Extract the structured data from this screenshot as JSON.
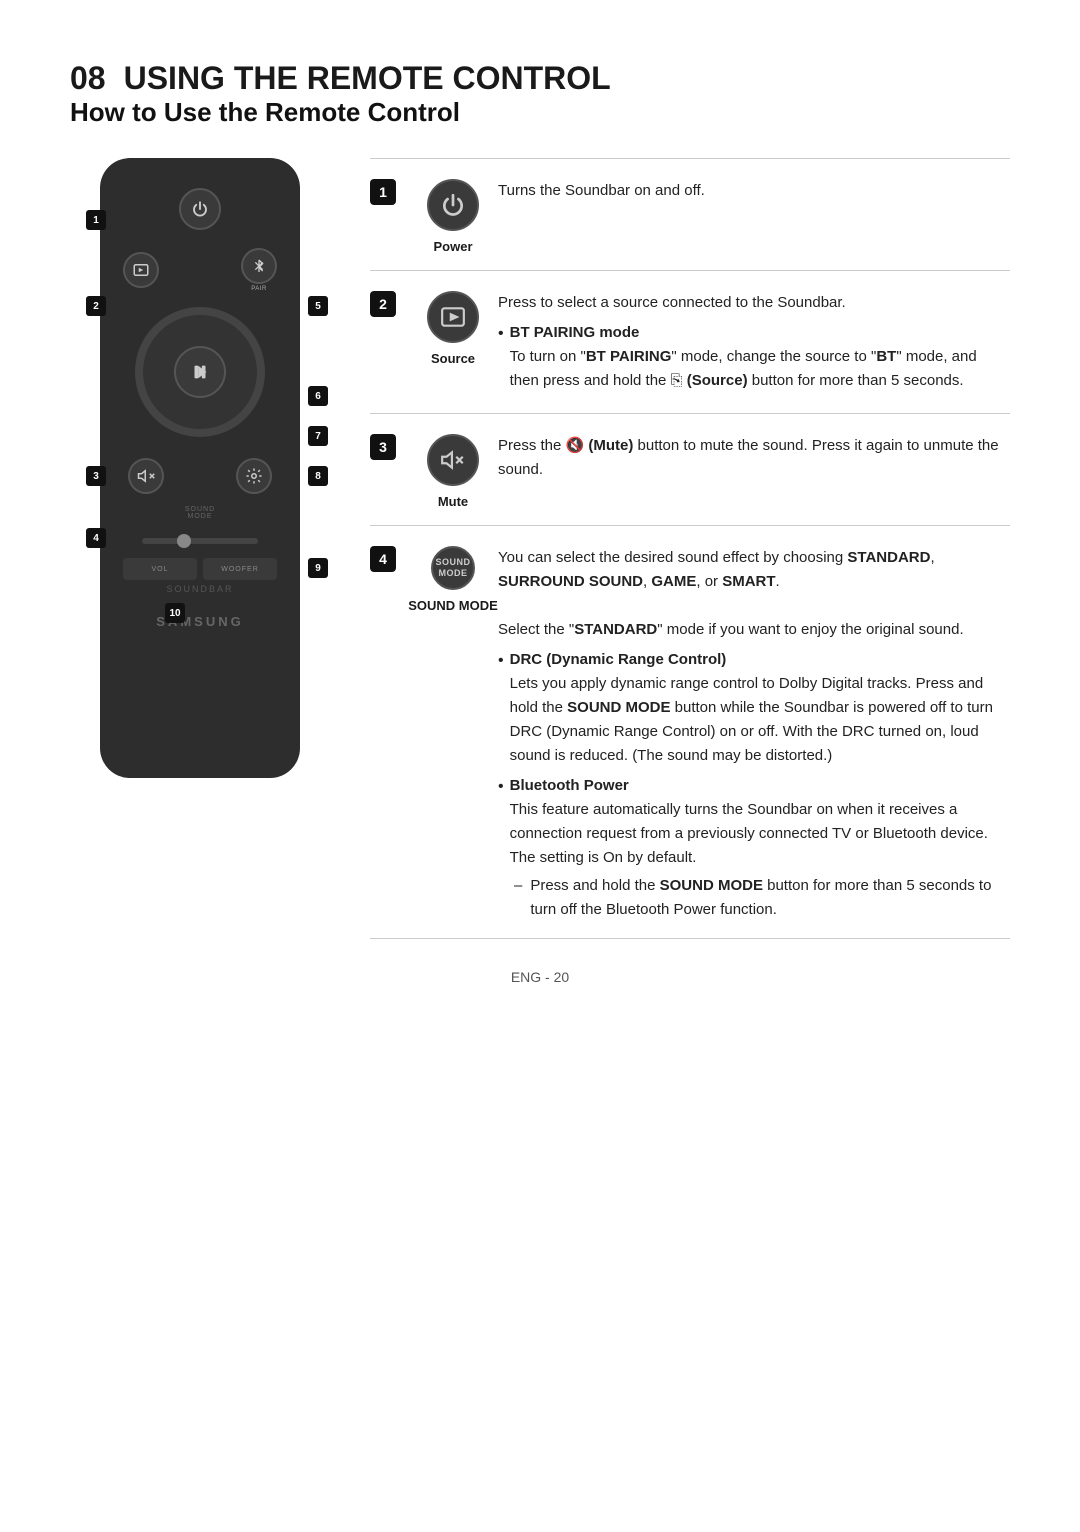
{
  "page": {
    "chapter": "08",
    "title": "USING THE REMOTE CONTROL",
    "section": "How to Use the Remote Control",
    "footer": "ENG - 20"
  },
  "remote": {
    "labels": {
      "samsung": "SAMSUNG",
      "soundbar": "SOUNDBAR",
      "pair": "PAIR",
      "sound_mode": "SOUND\nMODE",
      "vol": "VOL",
      "woofer": "WOOFER"
    },
    "numbers": [
      "1",
      "2",
      "3",
      "4",
      "5",
      "6",
      "7",
      "8",
      "9",
      "10"
    ]
  },
  "table": [
    {
      "num": "1",
      "icon_label": "Power",
      "icon_type": "power",
      "description": "Turns the Soundbar on and off."
    },
    {
      "num": "2",
      "icon_label": "Source",
      "icon_type": "source",
      "description_parts": [
        {
          "type": "text",
          "content": "Press to select a source connected to the Soundbar."
        },
        {
          "type": "bullet",
          "bold": "BT PAIRING mode"
        },
        {
          "type": "text",
          "content": "To turn on \"BT PAIRING\" mode, change the source to \"BT\" mode, and then press and hold the (Source) button for more than 5 seconds."
        }
      ]
    },
    {
      "num": "3",
      "icon_label": "Mute",
      "icon_type": "mute",
      "description": "Press the (Mute) button to mute the sound. Press it again to unmute the sound."
    },
    {
      "num": "4",
      "icon_label": "SOUND MODE",
      "icon_type": "sound_mode",
      "description_parts": [
        {
          "type": "text",
          "content": "You can select the desired sound effect by choosing STANDARD, SURROUND SOUND, GAME, or SMART."
        },
        {
          "type": "text",
          "content": "Select the \"STANDARD\" mode if you want to enjoy the original sound."
        },
        {
          "type": "bullet",
          "bold": "DRC (Dynamic Range Control)"
        },
        {
          "type": "text",
          "content": "Lets you apply dynamic range control to Dolby Digital tracks. Press and hold the SOUND MODE button while the Soundbar is powered off to turn DRC (Dynamic Range Control) on or off. With the DRC turned on, loud sound is reduced. (The sound may be distorted.)"
        },
        {
          "type": "bullet",
          "bold": "Bluetooth Power"
        },
        {
          "type": "text",
          "content": "This feature automatically turns the Soundbar on when it receives a connection request from a previously connected TV or Bluetooth device. The setting is On by default."
        },
        {
          "type": "sub_bullet",
          "content": "Press and hold the SOUND MODE button for more than 5 seconds to turn off the Bluetooth Power function."
        }
      ]
    }
  ]
}
